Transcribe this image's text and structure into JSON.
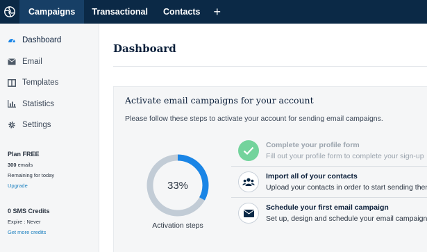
{
  "colors": {
    "topbar": "#0b2946",
    "active_tab": "#173f66",
    "progress": "#1a85e6",
    "track": "#c2ccd6",
    "done": "#73d39c",
    "link": "#1a7fbf"
  },
  "topnav": {
    "logo_icon": "sendinblue-logo-icon",
    "tabs": [
      {
        "label": "Campaigns",
        "active": true
      },
      {
        "label": "Transactional",
        "active": false
      },
      {
        "label": "Contacts",
        "active": false
      }
    ],
    "add_icon": "+"
  },
  "sidebar": {
    "items": [
      {
        "label": "Dashboard",
        "icon": "gauge-icon",
        "active": true
      },
      {
        "label": "Email",
        "icon": "envelope-icon",
        "active": false
      },
      {
        "label": "Templates",
        "icon": "columns-icon",
        "active": false
      },
      {
        "label": "Statistics",
        "icon": "bar-chart-icon",
        "active": false
      },
      {
        "label": "Settings",
        "icon": "gear-icon",
        "active": false
      }
    ],
    "plan": {
      "title": "Plan FREE",
      "emails_count": "300",
      "emails_unit": " emails",
      "remaining": "Remaining for today",
      "upgrade": "Upgrade"
    },
    "sms": {
      "title": "0 SMS Credits",
      "expire": "Expire : Never",
      "link": "Get more credits"
    }
  },
  "main": {
    "title": "Dashboard",
    "card": {
      "title": "Activate email campaigns for your account",
      "description": "Please follow these steps to activate your account for sending email campaigns.",
      "progress": {
        "label": "33%",
        "fraction": 0.33,
        "caption": "Activation steps"
      },
      "steps": [
        {
          "title": "Complete your profile form",
          "text": "Fill out your profile form to complete your sign-up",
          "icon": "check-icon",
          "done": true
        },
        {
          "title": "Import all of your contacts",
          "text": "Upload your contacts in order to start sending them",
          "icon": "users-icon",
          "done": false
        },
        {
          "title": "Schedule your first email campaign",
          "text": "Set up, design and schedule your email campaign",
          "icon": "envelope-icon",
          "done": false
        }
      ]
    }
  }
}
